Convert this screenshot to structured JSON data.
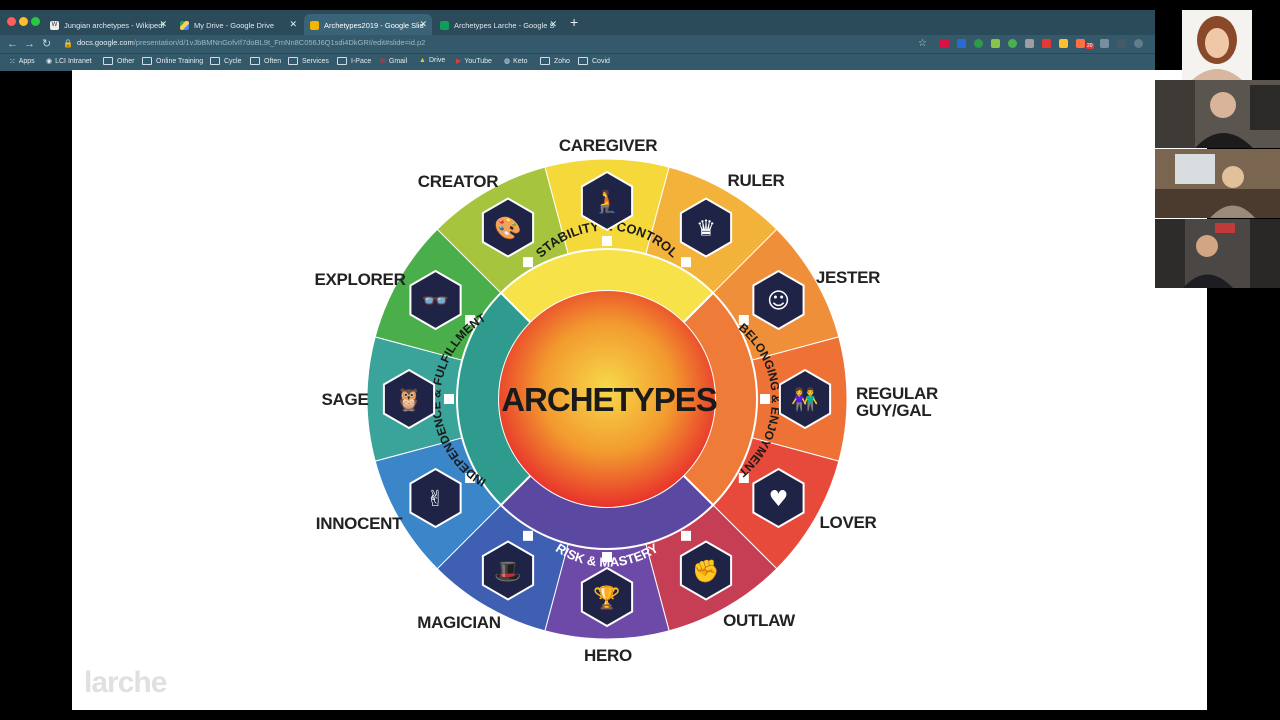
{
  "browser": {
    "tabs": [
      {
        "title": "Jungian archetypes - Wikipedi",
        "favicon": "W"
      },
      {
        "title": "My Drive - Google Drive",
        "favicon": ""
      },
      {
        "title": "Archetypes2019 - Google Slid",
        "favicon": ""
      },
      {
        "title": "Archetypes Larche - Google S",
        "favicon": ""
      }
    ],
    "new_tab": "+",
    "url": {
      "host": "docs.google.com",
      "path": "/presentation/d/1vJbBMNnGofvIf7doBL9t_FmNn8C056J6Q1sdi4DkGRI/edit#slide=id.p2"
    },
    "bookmarks": [
      "Apps",
      "LCI Intranet",
      "Other",
      "Online Training",
      "Cycle",
      "Often",
      "Services",
      "I-Pace",
      "Gmail",
      "Drive",
      "YouTube",
      "Keto",
      "Zoho",
      "Covid"
    ],
    "ext_badge": "20"
  },
  "slide": {
    "center_title": "ARCHETYPES",
    "quadrants": [
      "STABILITY & CONTROL",
      "BELONGING & ENJOYMENT",
      "RISK & MASTERY",
      "INDEPENDENCE & FULFILLMENT"
    ],
    "labels": {
      "caregiver": "CAREGIVER",
      "ruler": "RULER",
      "jester": "JESTER",
      "regular_line1": "REGULAR",
      "regular_line2": "GUY/GAL",
      "lover": "LOVER",
      "outlaw": "OUTLAW",
      "hero": "HERO",
      "magician": "MAGICIAN",
      "innocent": "INNOCENT",
      "sage": "SAGE",
      "explorer": "EXPLORER",
      "creator": "CREATOR"
    },
    "watermark": "larche",
    "colors": {
      "wheel_center": "#f7d94a",
      "wheel_outer": "#e8322c",
      "hex_icon": "#1f2447"
    }
  },
  "participants": [
    "video-participant-1",
    "video-participant-2",
    "video-participant-3",
    "video-participant-4"
  ]
}
